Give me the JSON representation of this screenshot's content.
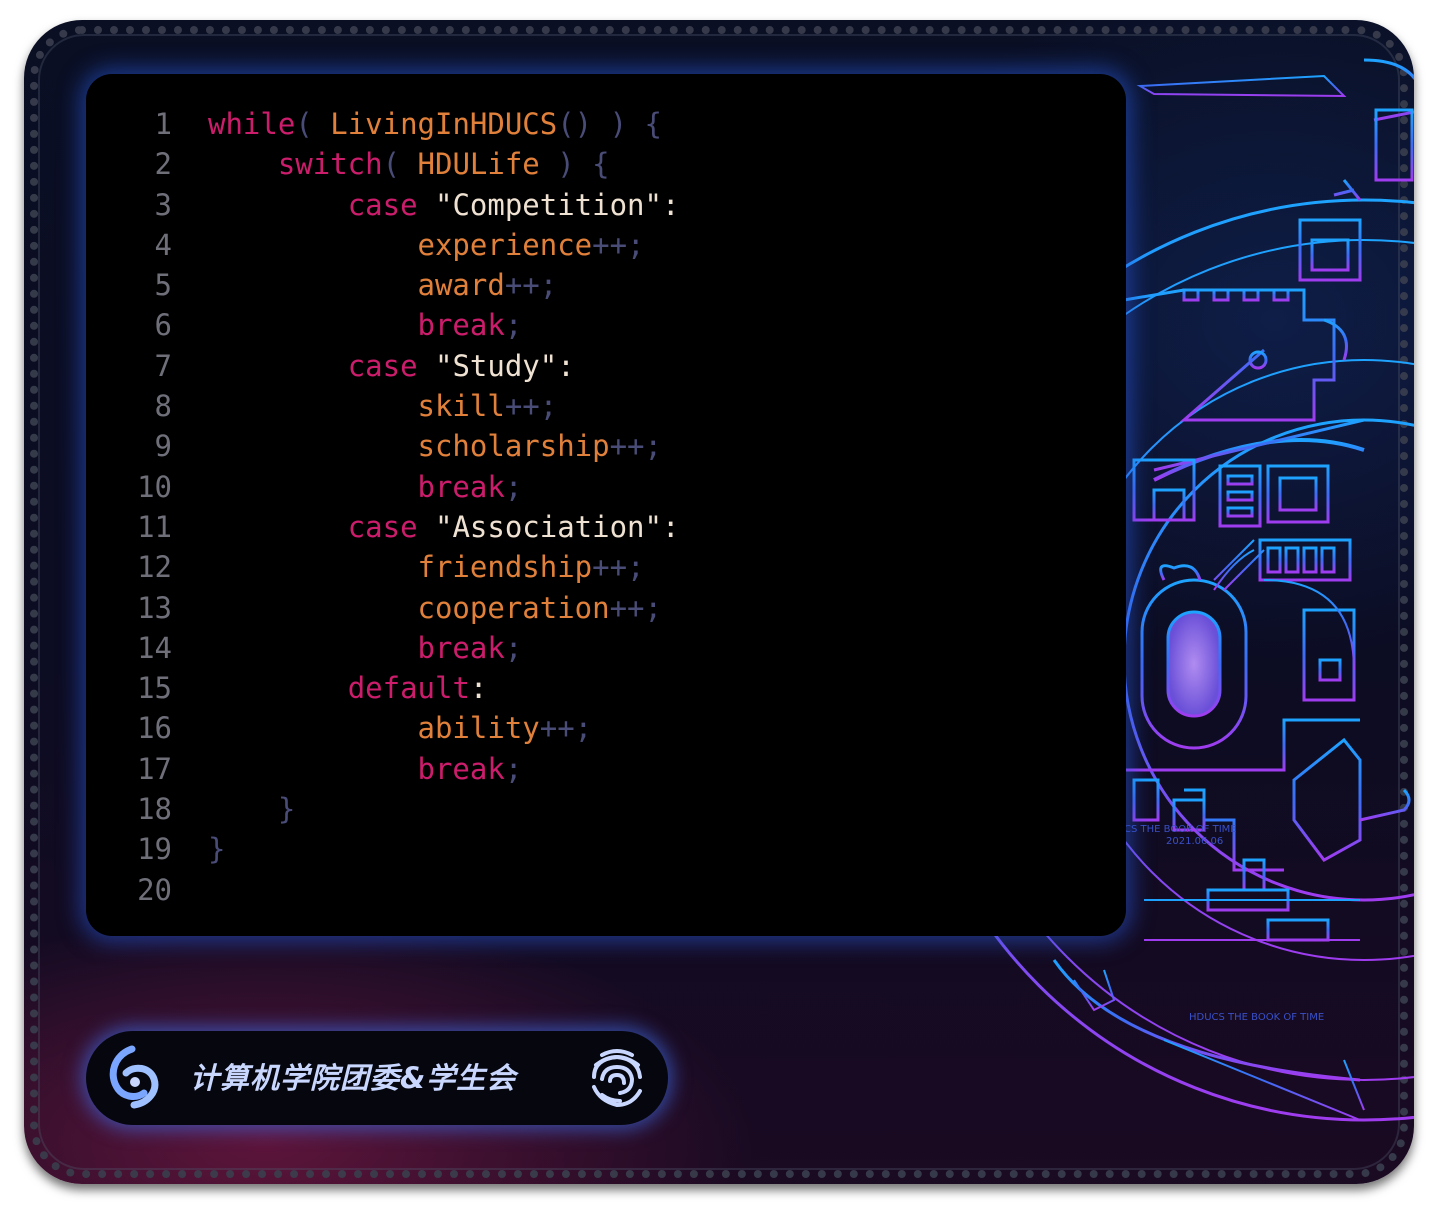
{
  "editor": {
    "lines": [
      {
        "n": "1",
        "parts": [
          {
            "t": "while",
            "c": "kw"
          },
          {
            "t": "( ",
            "c": "op"
          },
          {
            "t": "LivingInHDUCS",
            "c": "fn"
          },
          {
            "t": "() ) {",
            "c": "op"
          }
        ]
      },
      {
        "n": "2",
        "parts": [
          {
            "t": "    ",
            "c": "tx"
          },
          {
            "t": "switch",
            "c": "kw"
          },
          {
            "t": "( ",
            "c": "op"
          },
          {
            "t": "HDULife",
            "c": "fn"
          },
          {
            "t": " ) {",
            "c": "op"
          }
        ]
      },
      {
        "n": "3",
        "parts": [
          {
            "t": "        ",
            "c": "tx"
          },
          {
            "t": "case",
            "c": "kw"
          },
          {
            "t": " \"Competition\"",
            "c": "str"
          },
          {
            "t": ":",
            "c": "str"
          }
        ]
      },
      {
        "n": "4",
        "parts": [
          {
            "t": "            ",
            "c": "tx"
          },
          {
            "t": "experience",
            "c": "fn"
          },
          {
            "t": "++;",
            "c": "op"
          }
        ]
      },
      {
        "n": "5",
        "parts": [
          {
            "t": "            ",
            "c": "tx"
          },
          {
            "t": "award",
            "c": "fn"
          },
          {
            "t": "++;",
            "c": "op"
          }
        ]
      },
      {
        "n": "6",
        "parts": [
          {
            "t": "            ",
            "c": "tx"
          },
          {
            "t": "break",
            "c": "kw"
          },
          {
            "t": ";",
            "c": "op"
          }
        ]
      },
      {
        "n": "7",
        "parts": [
          {
            "t": "        ",
            "c": "tx"
          },
          {
            "t": "case",
            "c": "kw"
          },
          {
            "t": " \"Study\"",
            "c": "str"
          },
          {
            "t": ":",
            "c": "str"
          }
        ]
      },
      {
        "n": "8",
        "parts": [
          {
            "t": "            ",
            "c": "tx"
          },
          {
            "t": "skill",
            "c": "fn"
          },
          {
            "t": "++;",
            "c": "op"
          }
        ]
      },
      {
        "n": "9",
        "parts": [
          {
            "t": "            ",
            "c": "tx"
          },
          {
            "t": "scholarship",
            "c": "fn"
          },
          {
            "t": "++;",
            "c": "op"
          }
        ]
      },
      {
        "n": "10",
        "parts": [
          {
            "t": "            ",
            "c": "tx"
          },
          {
            "t": "break",
            "c": "kw"
          },
          {
            "t": ";",
            "c": "op"
          }
        ]
      },
      {
        "n": "11",
        "parts": [
          {
            "t": "        ",
            "c": "tx"
          },
          {
            "t": "case",
            "c": "kw"
          },
          {
            "t": " \"Association\"",
            "c": "str"
          },
          {
            "t": ":",
            "c": "str"
          }
        ]
      },
      {
        "n": "12",
        "parts": [
          {
            "t": "            ",
            "c": "tx"
          },
          {
            "t": "friendship",
            "c": "fn"
          },
          {
            "t": "++;",
            "c": "op"
          }
        ]
      },
      {
        "n": "13",
        "parts": [
          {
            "t": "            ",
            "c": "tx"
          },
          {
            "t": "cooperation",
            "c": "fn"
          },
          {
            "t": "++;",
            "c": "op"
          }
        ]
      },
      {
        "n": "14",
        "parts": [
          {
            "t": "            ",
            "c": "tx"
          },
          {
            "t": "break",
            "c": "kw"
          },
          {
            "t": ";",
            "c": "op"
          }
        ]
      },
      {
        "n": "15",
        "parts": [
          {
            "t": "        ",
            "c": "tx"
          },
          {
            "t": "default",
            "c": "kw"
          },
          {
            "t": ":",
            "c": "str"
          }
        ]
      },
      {
        "n": "16",
        "parts": [
          {
            "t": "            ",
            "c": "tx"
          },
          {
            "t": "ability",
            "c": "fn"
          },
          {
            "t": "++;",
            "c": "op"
          }
        ]
      },
      {
        "n": "17",
        "parts": [
          {
            "t": "            ",
            "c": "tx"
          },
          {
            "t": "break",
            "c": "kw"
          },
          {
            "t": ";",
            "c": "op"
          }
        ]
      },
      {
        "n": "18",
        "parts": [
          {
            "t": "    ",
            "c": "tx"
          },
          {
            "t": "}",
            "c": "op"
          }
        ]
      },
      {
        "n": "19",
        "parts": [
          {
            "t": "}",
            "c": "op"
          }
        ]
      },
      {
        "n": "20",
        "parts": []
      }
    ]
  },
  "footer": {
    "title": "计算机学院团委&学生会",
    "left_logo_icon": "hdu-swirl-logo-icon",
    "right_logo_icon": "fingerprint-spiral-logo-icon"
  },
  "artwork": {
    "caption_bottom": "HDUCS THE BOOK OF TIME",
    "caption_side": "CS THE BOOK OF TIME",
    "caption_date": "2021.06.06"
  },
  "colors": {
    "keyword": "#cc1d6c",
    "identifier": "#e0803a",
    "string": "#f0e2d2",
    "operator": "#4a4c78",
    "glow": "#3c6eeb"
  }
}
